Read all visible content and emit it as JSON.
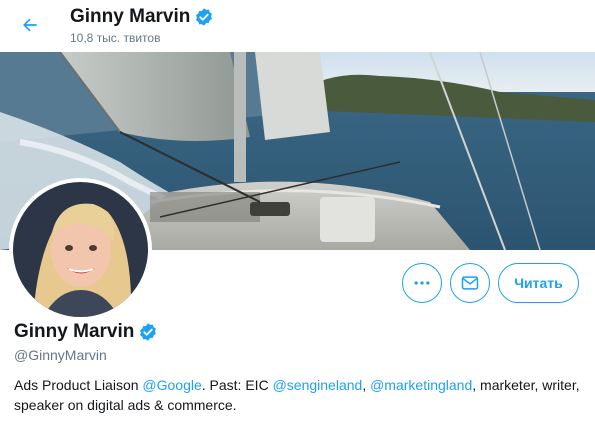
{
  "header": {
    "display_name": "Ginny Marvin",
    "tweet_count": "10,8 тыс. твитов"
  },
  "profile": {
    "display_name": "Ginny Marvin",
    "handle": "@GinnyMarvin",
    "verified": true,
    "bio": {
      "t1": "Ads Product Liaison ",
      "link_google": "@Google",
      "t2": ".  Past: EIC ",
      "link_sengineland": "@sengineland",
      "t3": ", ",
      "link_marketingland": "@marketingland",
      "t4": ", marketer, writer, speaker on digital ads & commerce."
    }
  },
  "actions": {
    "more_icon": "more-icon",
    "message_icon": "message-icon",
    "follow_label": "Читать"
  },
  "colors": {
    "accent": "#1da1f2",
    "secondary_text": "#657786",
    "primary_text": "#14171a"
  }
}
